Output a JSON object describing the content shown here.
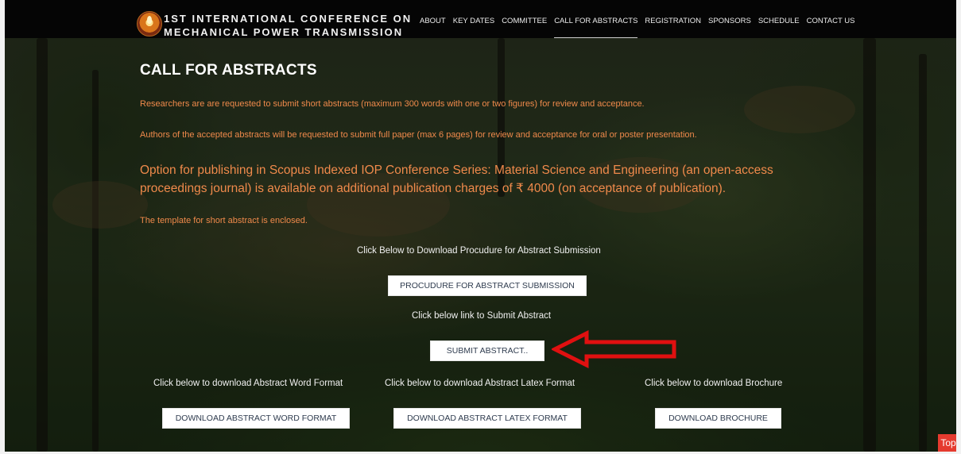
{
  "header": {
    "title_line1": "1ST INTERNATIONAL CONFERENCE ON",
    "title_line2": "MECHANICAL POWER TRANSMISSION",
    "logo_icon": "conference-logo-icon",
    "nav": [
      {
        "label": "ABOUT",
        "active": false
      },
      {
        "label": "KEY DATES",
        "active": false
      },
      {
        "label": "COMMITTEE",
        "active": false
      },
      {
        "label": "CALL FOR ABSTRACTS",
        "active": true
      },
      {
        "label": "REGISTRATION",
        "active": false
      },
      {
        "label": "SPONSORS",
        "active": false
      },
      {
        "label": "SCHEDULE",
        "active": false
      },
      {
        "label": "CONTACT US",
        "active": false
      }
    ]
  },
  "main": {
    "title": "CALL FOR ABSTRACTS",
    "paragraphs": [
      "Researchers are are requested to submit short abstracts (maximum 300 words with one or two figures) for review and acceptance.",
      "Authors of the accepted abstracts will be requested to submit full paper (max 6 pages) for review and acceptance for oral or poster presentation.",
      "Option for publishing in Scopus Indexed IOP Conference Series: Material Science and Engineering (an open-access proceedings journal) is available on additional publication charges of ₹ 4000 (on acceptance of publication).",
      "The template for short abstract is enclosed."
    ],
    "procedure_label": "Click Below to Download Procudure for Abstract Submission",
    "procedure_button": "PROCUDURE FOR ABSTRACT SUBMISSION",
    "submit_label": "Click below link to Submit Abstract",
    "submit_button": "SUBMIT ABSTRACT..",
    "word_label": "Click below to download Abstract Word Format",
    "word_button": "DOWNLOAD ABSTRACT WORD FORMAT",
    "latex_label": "Click below to download Abstract Latex Format",
    "latex_button": "DOWNLOAD ABSTRACT LATEX FORMAT",
    "brochure_label": "Click below to download Brochure",
    "brochure_button": "DOWNLOAD BROCHURE"
  },
  "annotation": {
    "arrow_icon": "red-arrow-left-icon",
    "arrow_color": "#e01010"
  },
  "top_button": "Top",
  "colors": {
    "header_bg": "#050505",
    "orange_text": "#f08a4b",
    "button_text": "#2e3b4e",
    "top_button_bg": "#e53a2e"
  }
}
